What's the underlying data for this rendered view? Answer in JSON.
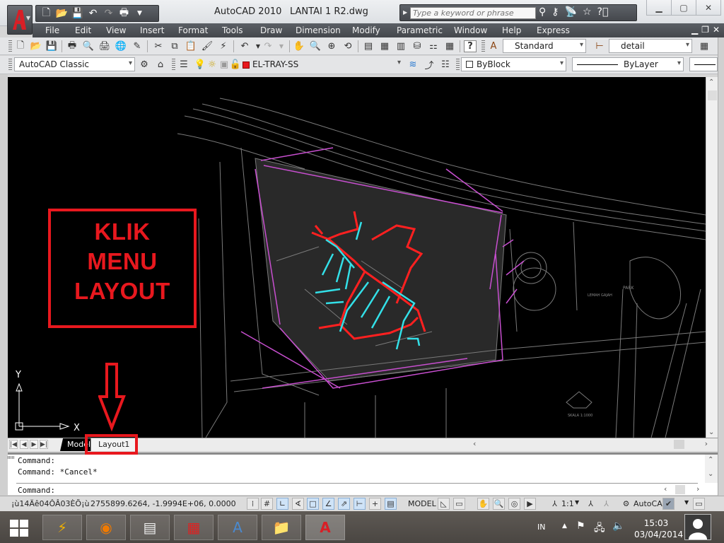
{
  "window": {
    "app_title": "AutoCAD 2010",
    "file_title": "LANTAI 1 R2.dwg",
    "search_placeholder": "Type a keyword or phrase",
    "controls": [
      "minimize",
      "restore",
      "close"
    ]
  },
  "quick_access": [
    "new-icon",
    "open-icon",
    "save-icon",
    "undo-icon",
    "redo-icon",
    "plot-icon",
    "customize-dropdown"
  ],
  "menubar": {
    "items": [
      "File",
      "Edit",
      "View",
      "Insert",
      "Format",
      "Tools",
      "Draw",
      "Dimension",
      "Modify",
      "Parametric",
      "Window",
      "Help",
      "Express"
    ]
  },
  "toolbars": {
    "workspace": "AutoCAD Classic",
    "layer": "EL-TRAY-SS",
    "layer_color": "#e8181e",
    "text_style": "Standard",
    "dim_style": "detail",
    "color": "ByBlock",
    "linetype": "ByLayer"
  },
  "annotation": {
    "lines": [
      "KLIK",
      "MENU",
      "LAYOUT"
    ],
    "color": "#e8181e"
  },
  "ucs": {
    "x_label": "X",
    "y_label": "Y"
  },
  "drawing": {
    "labels": [
      "PARK",
      "LEMAH GAJAH",
      "SKALA 1:1000"
    ],
    "colors": {
      "background": "#000000",
      "base": "#7a7a7a",
      "boundary": "#c84fd0",
      "tray_red": "#ff2020",
      "tray_cyan": "#33e0e8"
    }
  },
  "tabs": {
    "model": "Model",
    "layout": "Layout1"
  },
  "command": {
    "history": [
      "Command:",
      "Command: *Cancel*"
    ],
    "prompt": "Command:"
  },
  "status": {
    "text": "¡ù14Äê04ÔÂ03ÈÕ¡ù",
    "coordinates": "2755899.6264, -1.9994E+06, 0.0000",
    "model_label": "MODEL",
    "annotation_scale": "1:1",
    "workspace_label": "AutoCA"
  },
  "taskbar": {
    "apps": [
      "windows-start",
      "winamp",
      "firefox",
      "reader",
      "spreadsheet",
      "wordpad",
      "file-explorer",
      "autocad-2010"
    ],
    "language": "IN",
    "time": "15:03",
    "date": "03/04/2014"
  }
}
